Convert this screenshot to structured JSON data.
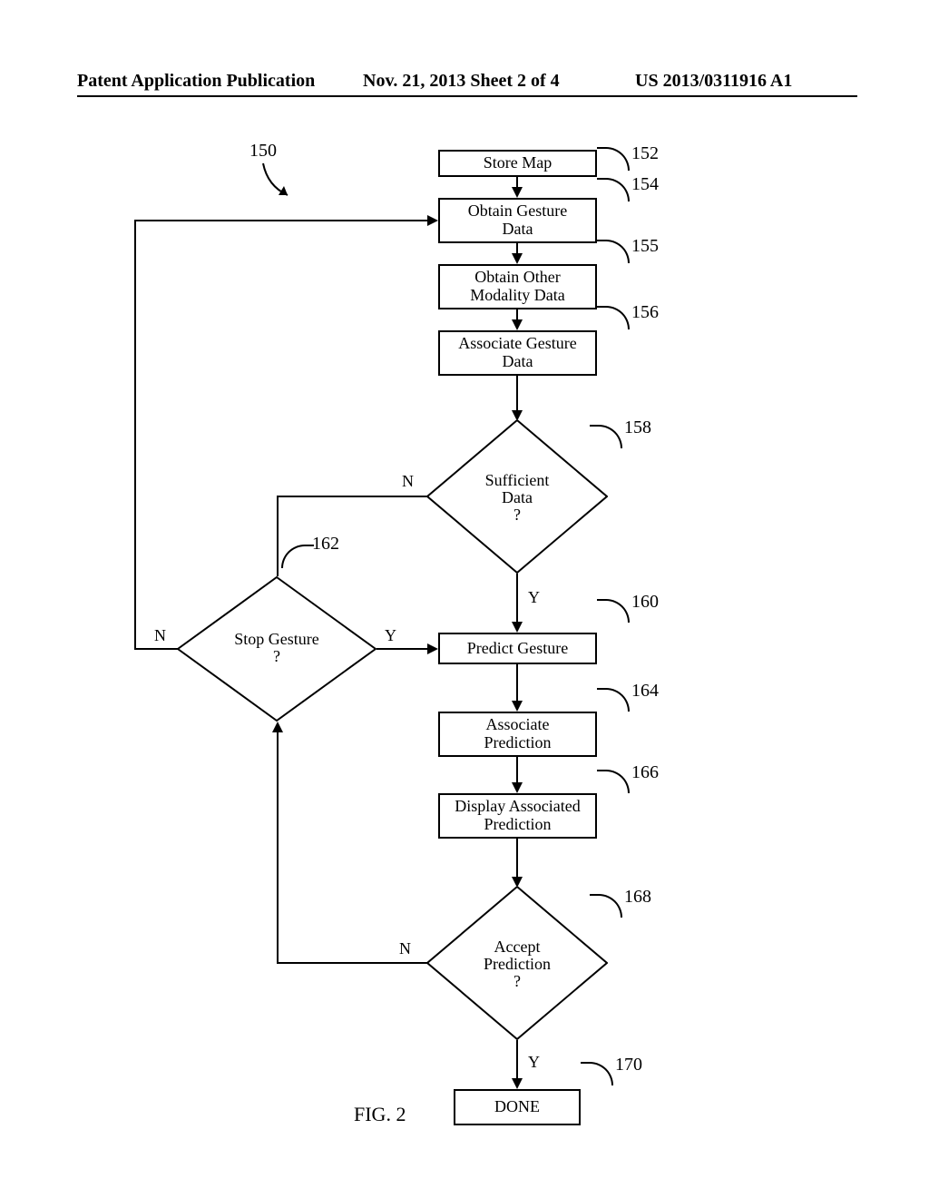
{
  "header": {
    "left": "Patent Application Publication",
    "center": "Nov. 21, 2013  Sheet 2 of 4",
    "right": "US 2013/0311916 A1"
  },
  "figure_caption": "FIG. 2",
  "refs": {
    "r150": "150",
    "r152": "152",
    "r154": "154",
    "r155": "155",
    "r156": "156",
    "r158": "158",
    "r160": "160",
    "r162": "162",
    "r164": "164",
    "r166": "166",
    "r168": "168",
    "r170": "170"
  },
  "boxes": {
    "store_map": "Store Map",
    "obtain_gesture": "Obtain Gesture\nData",
    "obtain_other": "Obtain Other\nModality Data",
    "associate_gesture": "Associate Gesture\nData",
    "predict_gesture": "Predict Gesture",
    "associate_prediction": "Associate\nPrediction",
    "display_prediction": "Display Associated\nPrediction",
    "done": "DONE"
  },
  "diamonds": {
    "sufficient": "Sufficient\nData\n?",
    "stop_gesture": "Stop Gesture\n?",
    "accept": "Accept\nPrediction\n?"
  },
  "edge_labels": {
    "Y": "Y",
    "N": "N"
  },
  "chart_data": {
    "type": "flowchart",
    "title": "FIG. 2",
    "nodes": [
      {
        "id": 150,
        "kind": "pointer",
        "label": "150"
      },
      {
        "id": 152,
        "kind": "process",
        "label": "Store Map"
      },
      {
        "id": 154,
        "kind": "process",
        "label": "Obtain Gesture Data"
      },
      {
        "id": 155,
        "kind": "process",
        "label": "Obtain Other Modality Data"
      },
      {
        "id": 156,
        "kind": "process",
        "label": "Associate Gesture Data"
      },
      {
        "id": 158,
        "kind": "decision",
        "label": "Sufficient Data ?"
      },
      {
        "id": 160,
        "kind": "process",
        "label": "Predict Gesture"
      },
      {
        "id": 162,
        "kind": "decision",
        "label": "Stop Gesture ?"
      },
      {
        "id": 164,
        "kind": "process",
        "label": "Associate Prediction"
      },
      {
        "id": 166,
        "kind": "process",
        "label": "Display Associated Prediction"
      },
      {
        "id": 168,
        "kind": "decision",
        "label": "Accept Prediction ?"
      },
      {
        "id": 170,
        "kind": "terminator",
        "label": "DONE"
      }
    ],
    "edges": [
      {
        "from": 152,
        "to": 154
      },
      {
        "from": 154,
        "to": 155
      },
      {
        "from": 155,
        "to": 156
      },
      {
        "from": 156,
        "to": 158
      },
      {
        "from": 158,
        "to": 160,
        "label": "Y"
      },
      {
        "from": 158,
        "to": 162,
        "label": "N"
      },
      {
        "from": 162,
        "to": 160,
        "label": "Y"
      },
      {
        "from": 162,
        "to": 154,
        "label": "N"
      },
      {
        "from": 160,
        "to": 164
      },
      {
        "from": 164,
        "to": 166
      },
      {
        "from": 166,
        "to": 168
      },
      {
        "from": 168,
        "to": 170,
        "label": "Y"
      },
      {
        "from": 168,
        "to": 162,
        "label": "N"
      }
    ]
  }
}
